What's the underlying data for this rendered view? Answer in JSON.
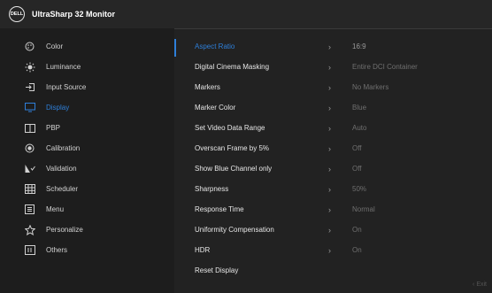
{
  "header": {
    "logo_text": "DELL",
    "title": "UltraSharp 32 Monitor"
  },
  "sidebar": {
    "items": [
      {
        "label": "Color"
      },
      {
        "label": "Luminance"
      },
      {
        "label": "Input Source"
      },
      {
        "label": "Display"
      },
      {
        "label": "PBP"
      },
      {
        "label": "Calibration"
      },
      {
        "label": "Validation"
      },
      {
        "label": "Scheduler"
      },
      {
        "label": "Menu"
      },
      {
        "label": "Personalize"
      },
      {
        "label": "Others"
      }
    ]
  },
  "main": {
    "rows": [
      {
        "name": "Aspect Ratio",
        "chevron": "›",
        "value": "16:9"
      },
      {
        "name": "Digital Cinema Masking",
        "chevron": "›",
        "value": "Entire DCI Container"
      },
      {
        "name": "Markers",
        "chevron": "›",
        "value": "No Markers"
      },
      {
        "name": "Marker Color",
        "chevron": "›",
        "value": "Blue"
      },
      {
        "name": "Set Video Data Range",
        "chevron": "›",
        "value": "Auto"
      },
      {
        "name": "Overscan Frame by 5%",
        "chevron": "›",
        "value": "Off"
      },
      {
        "name": "Show Blue Channel only",
        "chevron": "›",
        "value": "Off"
      },
      {
        "name": "Sharpness",
        "chevron": "›",
        "value": "50%"
      },
      {
        "name": "Response Time",
        "chevron": "›",
        "value": "Normal"
      },
      {
        "name": "Uniformity Compensation",
        "chevron": "›",
        "value": "On"
      },
      {
        "name": "HDR",
        "chevron": "›",
        "value": "On"
      },
      {
        "name": "Reset Display",
        "chevron": "",
        "value": ""
      }
    ]
  },
  "footer": {
    "exit_label": "‹  Exit"
  },
  "colors": {
    "accent": "#2e7fd9",
    "background": "#1d1d1d",
    "panel": "#222222"
  }
}
